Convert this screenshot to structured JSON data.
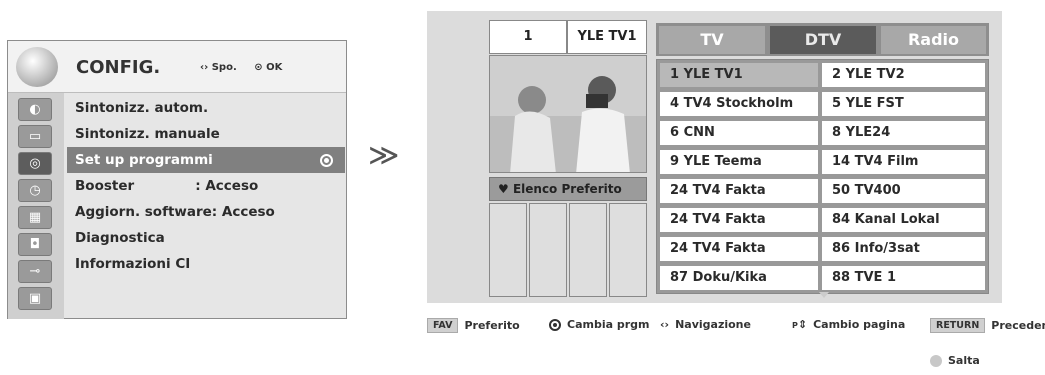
{
  "config_menu": {
    "title": "CONFIG.",
    "hint_move": "Spo.",
    "hint_ok": "OK",
    "items": [
      {
        "label": "Sintonizz. autom.",
        "selected": false
      },
      {
        "label": "Sintonizz. manuale",
        "selected": false
      },
      {
        "label": "Set up programmi",
        "selected": true
      },
      {
        "label": "Booster             : Acceso",
        "selected": false
      },
      {
        "label": "Aggiorn. software: Acceso",
        "selected": false
      },
      {
        "label": "Diagnostica",
        "selected": false
      },
      {
        "label": "Informazioni CI",
        "selected": false
      }
    ],
    "side_icons": [
      "satellite-icon",
      "tv-icon",
      "disc-icon",
      "clock-icon",
      "lock-icon",
      "padlock-icon",
      "plug-icon",
      "picture-icon"
    ]
  },
  "arrow_glyph": "≫",
  "channel_panel": {
    "current_number": "1",
    "current_name": "YLE TV1",
    "favourite_label": "Elenco Preferito",
    "tabs": [
      {
        "label": "TV",
        "active": false
      },
      {
        "label": "DTV",
        "active": true
      },
      {
        "label": "Radio",
        "active": false
      }
    ],
    "channels_left": [
      "1 YLE TV1",
      "4 TV4 Stockholm",
      "6 CNN",
      "9 YLE Teema",
      "24 TV4 Fakta",
      "24 TV4 Fakta",
      "24 TV4 Fakta",
      "87 Doku/Kika"
    ],
    "channels_right": [
      "2 YLE TV2",
      "5 YLE FST",
      "8 YLE24",
      "14 TV4 Film",
      "50 TV400",
      "84 Kanal Lokal",
      "86 Info/3sat",
      "88 TVE 1"
    ]
  },
  "legend": {
    "fav_key": "FAV",
    "fav_label": "Preferito",
    "change_label": "Cambia prgm",
    "nav_label": "Navigazione",
    "page_key": "P",
    "page_label": "Cambio pagina",
    "return_key": "RETURN",
    "return_label": "Precedente",
    "skip_label": "Salta"
  }
}
